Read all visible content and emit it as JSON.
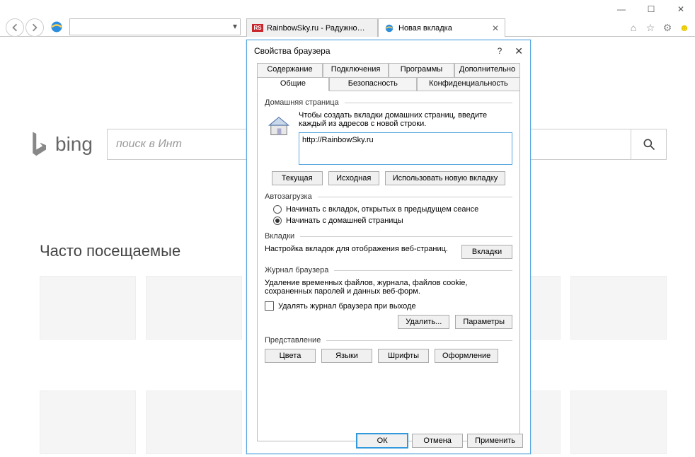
{
  "browser": {
    "tabs": [
      {
        "label": "RainbowSky.ru - Радужное Не…",
        "favicon": "RS"
      },
      {
        "label": "Новая вкладка",
        "favicon": "ie"
      }
    ]
  },
  "page": {
    "bing_text": "bing",
    "search_placeholder": "поиск в Инт",
    "frequent_title": "Часто посещаемые"
  },
  "dialog": {
    "title": "Свойства браузера",
    "tabs_row1": [
      "Содержание",
      "Подключения",
      "Программы",
      "Дополнительно"
    ],
    "tabs_row2": [
      "Общие",
      "Безопасность",
      "Конфиденциальность"
    ],
    "active_tab": "Общие",
    "home": {
      "title": "Домашняя страница",
      "desc": "Чтобы создать вкладки домашних страниц, введите каждый из адресов с новой строки.",
      "url": "http://RainbowSky.ru",
      "btn_current": "Текущая",
      "btn_default": "Исходная",
      "btn_newtab": "Использовать новую вкладку"
    },
    "startup": {
      "title": "Автозагрузка",
      "opt1": "Начинать с вкладок, открытых в предыдущем сеансе",
      "opt2": "Начинать с домашней страницы",
      "selected": 1
    },
    "tabs": {
      "title": "Вкладки",
      "desc": "Настройка вкладок для отображения веб-страниц.",
      "btn": "Вкладки"
    },
    "history": {
      "title": "Журнал браузера",
      "desc": "Удаление временных файлов, журнала, файлов cookie, сохраненных паролей и данных веб-форм.",
      "chk": "Удалять журнал браузера при выходе",
      "btn_delete": "Удалить...",
      "btn_params": "Параметры"
    },
    "appearance": {
      "title": "Представление",
      "btn_colors": "Цвета",
      "btn_langs": "Языки",
      "btn_fonts": "Шрифты",
      "btn_style": "Оформление"
    },
    "buttons": {
      "ok": "ОК",
      "cancel": "Отмена",
      "apply": "Применить"
    }
  }
}
